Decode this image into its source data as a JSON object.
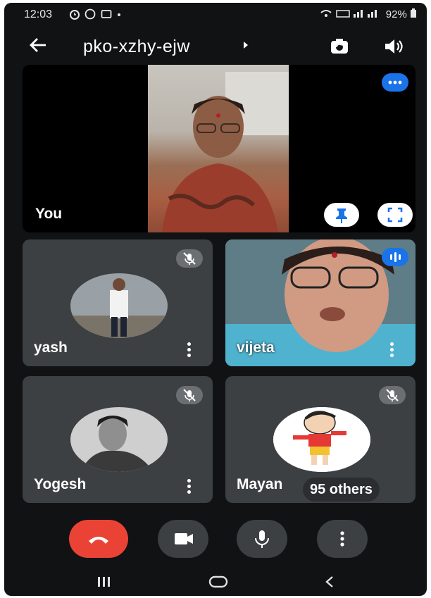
{
  "status_bar": {
    "time": "12:03",
    "battery": "92%"
  },
  "meeting": {
    "code": "pko-xzhy-ejw"
  },
  "self_tile": {
    "label": "You"
  },
  "participants": [
    {
      "name": "yash"
    },
    {
      "name": "vijeta"
    },
    {
      "name": "Yogesh"
    },
    {
      "name": "Mayan"
    }
  ],
  "others": {
    "label": "95 others"
  },
  "colors": {
    "end_call": "#ea4335",
    "tile": "#3c4043",
    "accent": "#1a73e8"
  },
  "icons": [
    "back-arrow-icon",
    "switch-camera-icon",
    "speaker-icon",
    "pin-icon",
    "fullscreen-icon",
    "mic-off-icon",
    "end-call-icon",
    "camera-icon",
    "mic-icon",
    "more-options-icon"
  ]
}
